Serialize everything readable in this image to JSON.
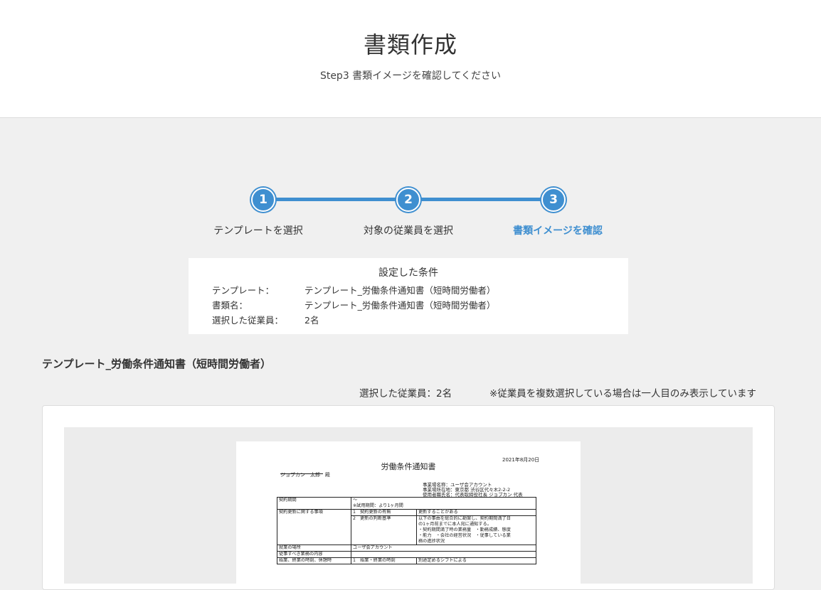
{
  "header": {
    "title": "書類作成",
    "subtitle": "Step3 書類イメージを確認してください"
  },
  "stepper": {
    "steps": [
      {
        "number": "1",
        "label": "テンプレートを選択",
        "active": false
      },
      {
        "number": "2",
        "label": "対象の従業員を選択",
        "active": false
      },
      {
        "number": "3",
        "label": "書類イメージを確認",
        "active": true
      }
    ]
  },
  "conditions": {
    "title": "設定した条件",
    "rows": [
      {
        "key": "テンプレート：",
        "value": "テンプレート_労働条件通知書（短時間労働者）"
      },
      {
        "key": "書類名：",
        "value": "テンプレート_労働条件通知書（短時間労働者）"
      },
      {
        "key": "選択した従業員：",
        "value": "2名"
      }
    ]
  },
  "document": {
    "heading": "テンプレート_労働条件通知書（短時間労働者）",
    "selected_count": "選択した従業員：2名",
    "note": "※従業員を複数選択している場合は一人目のみ表示しています"
  },
  "paper": {
    "date": "2021年8月20日",
    "title": "労働条件通知書",
    "addressee": "ジョブカン　太郎　殿",
    "company_lines": [
      "事業場名称：ユーザ会アカウント",
      "事業場所在地：東京都 渋谷区代々木2-2-2",
      "使用者職氏名：代表取締役社長 ジョブカン 代表"
    ],
    "rows": {
      "contract_period": "契約期間",
      "contract_period_v1": "～",
      "contract_period_v2": "※試用期間：より1ヶ月間",
      "renewal": "契約更新に関する事項",
      "renewal_a": "1　契約更新の有無",
      "renewal_a_v": "更新することがある",
      "renewal_b": "2　更新の判断基準",
      "renewal_b_v1": "以下の事由を総合的に勘案し、契約期間満了日",
      "renewal_b_v2": "の1ヶ月前までに本人宛に通知する。",
      "renewal_b_v3": "・契約期間満了時の業務量　・勤務成績、態度",
      "renewal_b_v4": "・能力　・会社の経営状況　・従事している業",
      "renewal_b_v5": "務の進捗状況",
      "workplace": "就業の場所",
      "workplace_v": "ユーザ会アカウント",
      "duties": "従事すべき業務の内容",
      "hours": "始業、終業の時刻、休憩時",
      "hours_a": "1　始業・終業の時刻",
      "hours_a_v": "別途定めるシフトによる"
    }
  }
}
